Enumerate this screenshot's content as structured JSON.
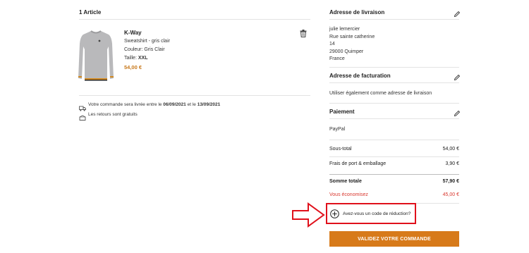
{
  "cart": {
    "heading": "1 Article",
    "item": {
      "brand": "K-Way",
      "name": "Sweatshirt - gris clair",
      "color_label": "Couleur: Gris Clair",
      "size_label": "Taille:",
      "size_value": "XXL",
      "price": "54,00 €"
    },
    "delivery": {
      "prefix": "Votre commande sera livrée entre le",
      "date_start": "06/09/2021",
      "middle": "et le",
      "date_end": "13/09/2021"
    },
    "returns": "Les retours sont gratuits"
  },
  "shipping": {
    "title": "Adresse de livraison",
    "lines": [
      "julie lemercier",
      "Rue sainte catherine",
      "14",
      "29000 Quimper",
      "France"
    ]
  },
  "billing": {
    "title": "Adresse de facturation",
    "text": "Utiliser également comme adresse de livraison"
  },
  "payment": {
    "title": "Paiement",
    "method": "PayPal"
  },
  "summary": {
    "subtotal_label": "Sous-total",
    "subtotal_value": "54,00 €",
    "shipping_label": "Frais de port & emballage",
    "shipping_value": "3,90 €",
    "total_label": "Somme totale",
    "total_value": "57,90 €",
    "savings_label": "Vous économisez",
    "savings_value": "45,00 €"
  },
  "promo": {
    "label": "Avez-vous un code de réduction?"
  },
  "checkout": {
    "button_label": "VALIDEZ VOTRE COMMANDE"
  },
  "colors": {
    "accent": "#d77a1a",
    "price": "#c8791c",
    "savings": "#d9382f",
    "annotation": "#e0101b"
  }
}
